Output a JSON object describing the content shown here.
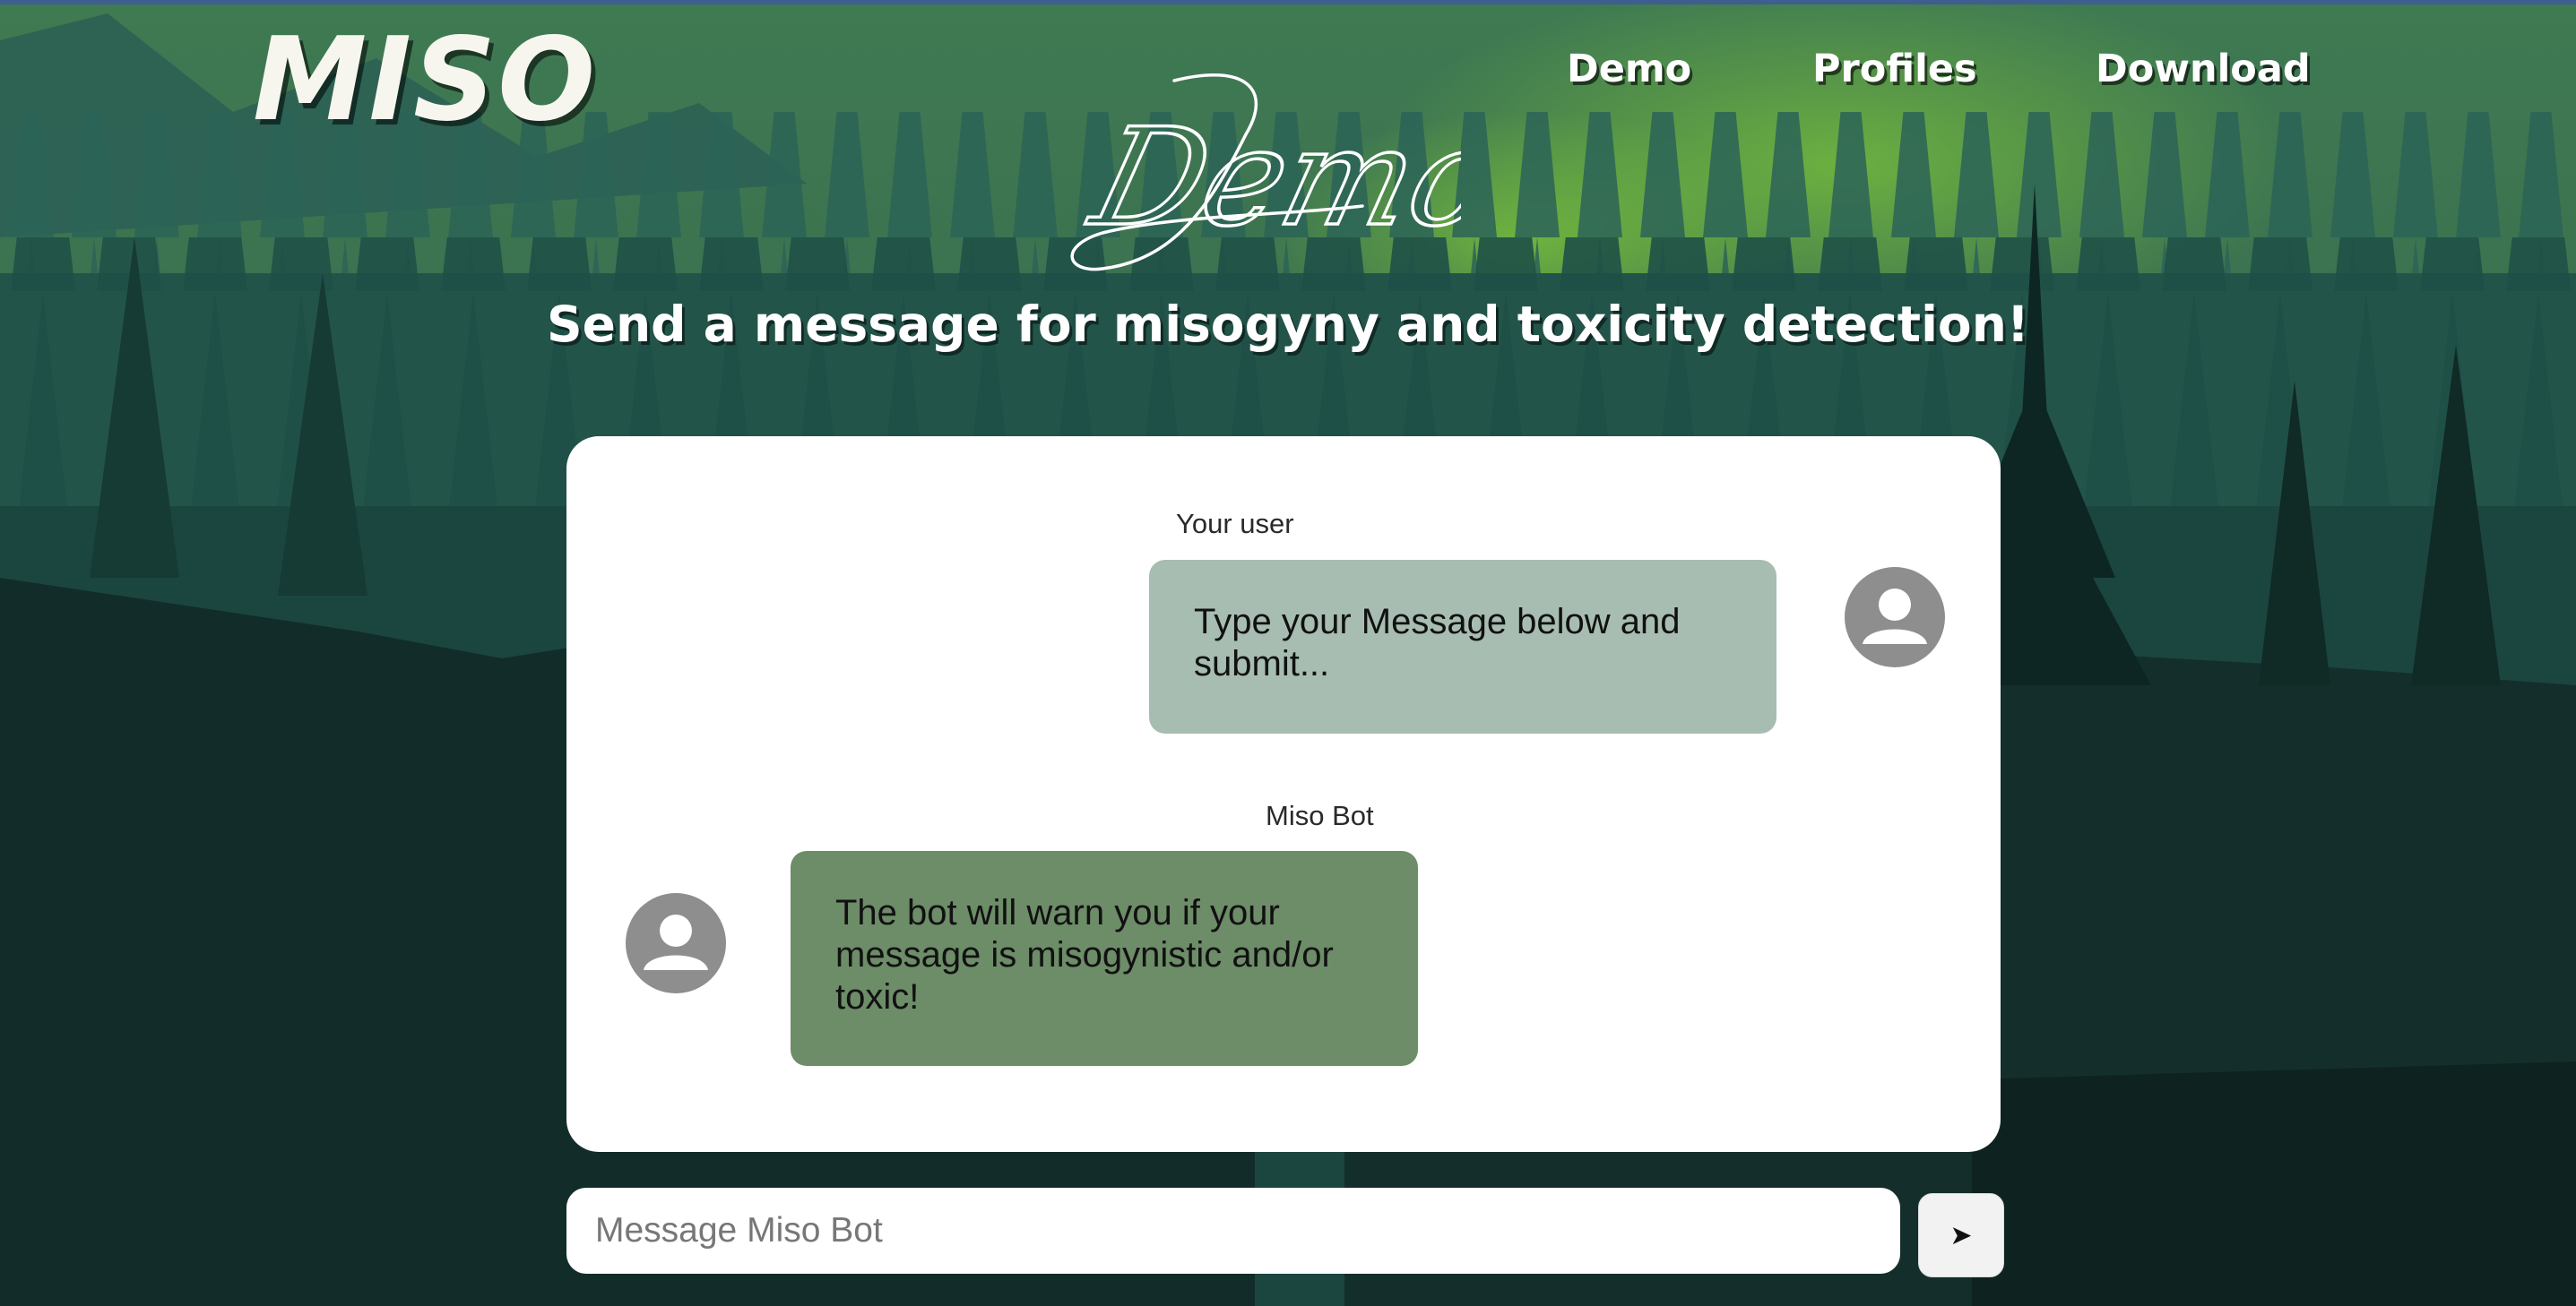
{
  "brand": {
    "logo": "MISO"
  },
  "nav": {
    "items": [
      {
        "label": "Demo"
      },
      {
        "label": "Profiles"
      },
      {
        "label": "Download"
      }
    ]
  },
  "hero": {
    "script_title": "Demo",
    "headline": "Send a message for misogyny and toxicity detection!"
  },
  "chat": {
    "messages": [
      {
        "sender": "Your user",
        "text": "Type your Message below and submit...",
        "side": "right",
        "bubble_color": "#a8bdb2"
      },
      {
        "sender": "Miso Bot",
        "text": "The bot will warn you if your message is misogynistic and/or toxic!",
        "side": "left",
        "bubble_color": "#6d8c68"
      }
    ],
    "avatar_icon": "user-avatar-icon"
  },
  "composer": {
    "placeholder": "Message Miso Bot",
    "send_label": "➤",
    "send_icon": "send-arrow-icon"
  },
  "colors": {
    "forest_dark": "#163a34",
    "forest_light": "#3c7b4e",
    "glow": "#6dc23a",
    "avatar_gray": "#8e8e8e"
  }
}
